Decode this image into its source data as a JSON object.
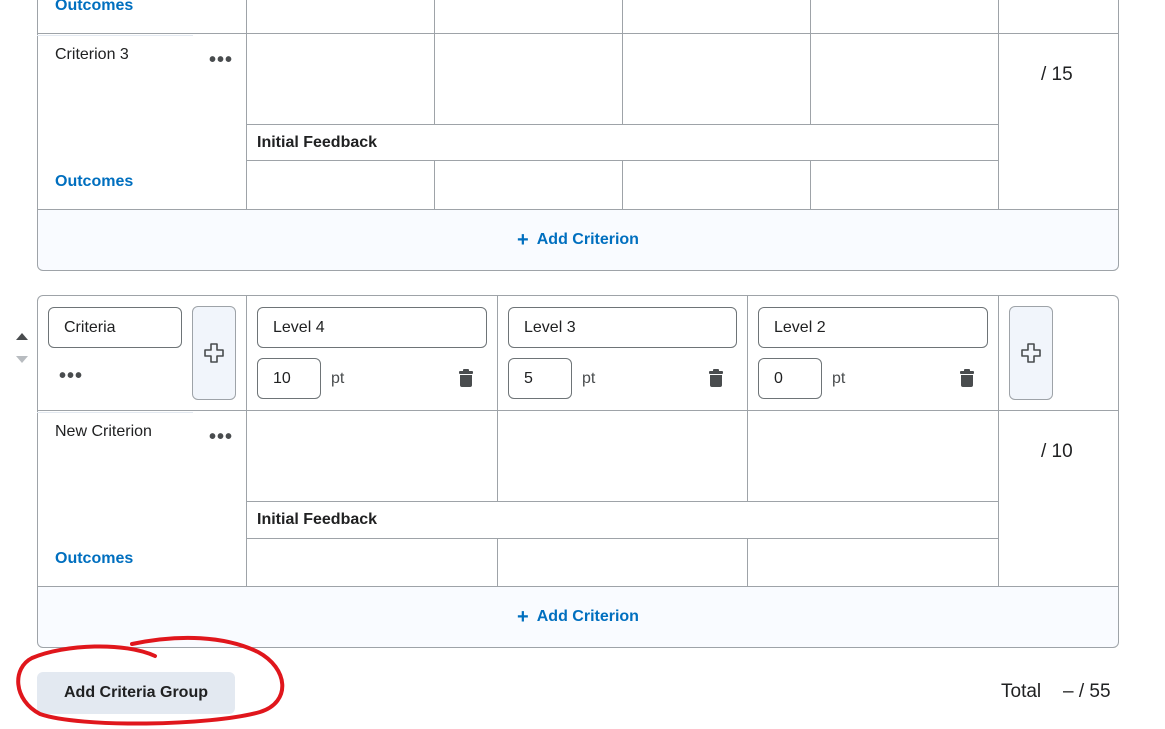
{
  "group1": {
    "outcomes_top": "Outcomes",
    "criterion": {
      "name": "Criterion 3",
      "menu": "•••",
      "outcomes": "Outcomes",
      "out_of": "/ 15",
      "feedback_label": "Initial Feedback"
    },
    "add_criterion": "Add Criterion",
    "add_criterion_icon": "plus-icon"
  },
  "group2": {
    "criteria_header": "Criteria",
    "header_menu": "•••",
    "levels": [
      {
        "name": "Level 4",
        "points": "10",
        "unit": "pt"
      },
      {
        "name": "Level 3",
        "points": "5",
        "unit": "pt"
      },
      {
        "name": "Level 2",
        "points": "0",
        "unit": "pt"
      }
    ],
    "criterion": {
      "name": "New Criterion",
      "menu": "•••",
      "outcomes": "Outcomes",
      "out_of": "/ 10",
      "feedback_label": "Initial Feedback"
    },
    "add_criterion": "Add Criterion",
    "add_criterion_icon": "plus-icon"
  },
  "footer": {
    "add_group": "Add Criteria Group",
    "total_label": "Total",
    "total_value": "– / 55"
  },
  "colors": {
    "link": "#006fbf",
    "border": "#9ea3a8",
    "button_bg": "#e3e9f1",
    "annotation": "#e0161c"
  }
}
